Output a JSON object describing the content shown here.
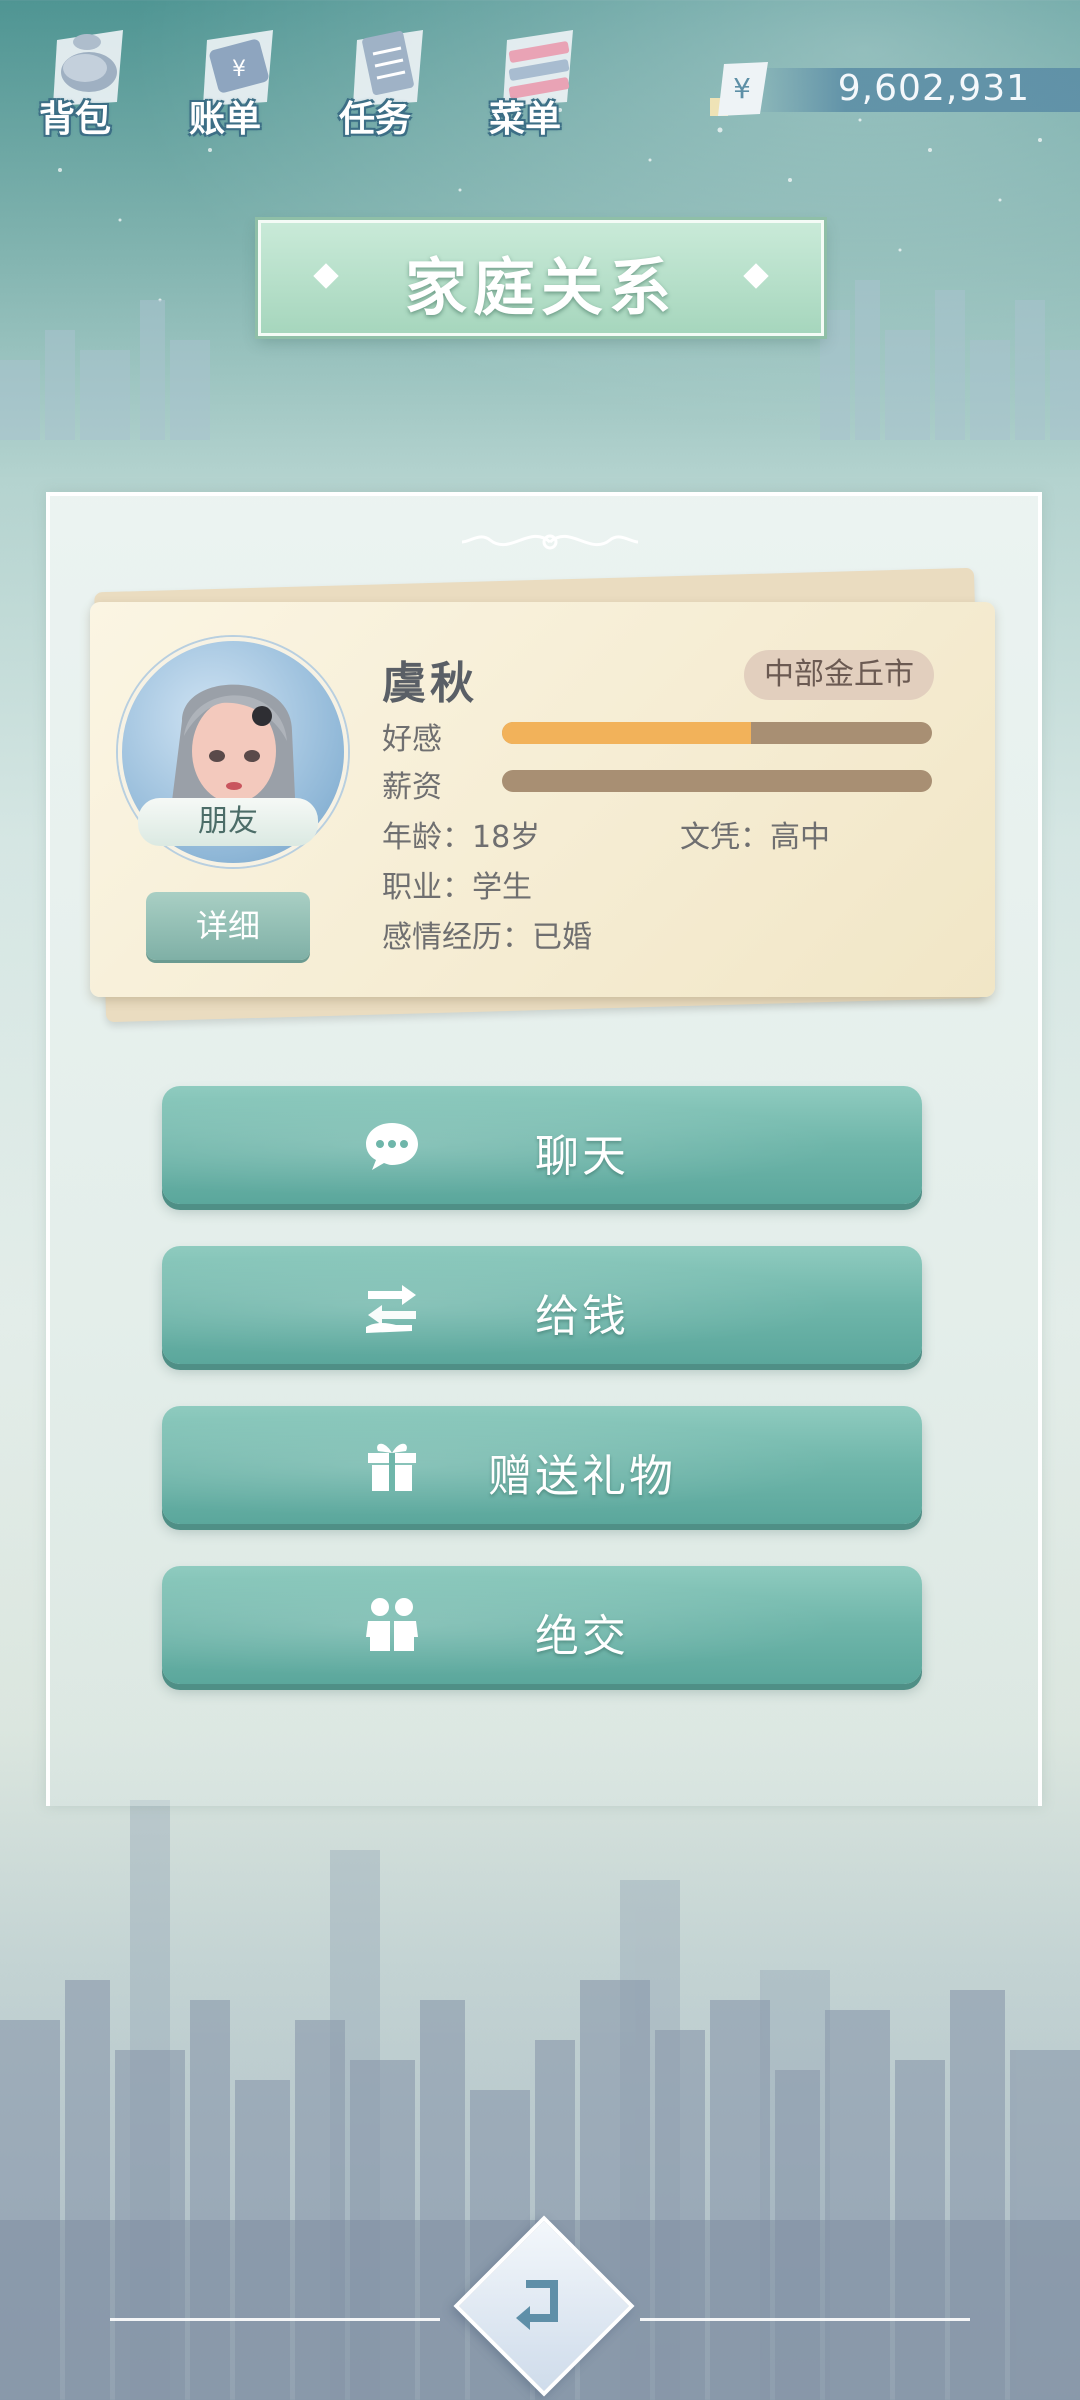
{
  "toolbar": {
    "items": [
      {
        "label": "背包",
        "icon": "backpack-icon"
      },
      {
        "label": "账单",
        "icon": "bill-icon"
      },
      {
        "label": "任务",
        "icon": "task-icon"
      },
      {
        "label": "菜单",
        "icon": "menu-icon"
      }
    ]
  },
  "money": {
    "currency_symbol": "¥",
    "value": "9,602,931"
  },
  "title": "家庭关系",
  "profile": {
    "name": "虞秋",
    "location": "中部金丘市",
    "relation": "朋友",
    "detail_label": "详细",
    "favor_label": "好感",
    "favor_level": 0.58,
    "salary_label": "薪资",
    "salary_level": 0.0,
    "age": "年龄：18岁",
    "education": "文凭：高中",
    "job": "职业：学生",
    "relationship_history": "感情经历：已婚"
  },
  "actions": [
    {
      "label": "聊天",
      "icon": "chat-bubble-icon"
    },
    {
      "label": "给钱",
      "icon": "give-money-icon"
    },
    {
      "label": "赠送礼物",
      "icon": "gift-icon"
    },
    {
      "label": "绝交",
      "icon": "break-friendship-icon"
    }
  ],
  "colors": {
    "accent_teal": "#6fb6aa",
    "favor_bar": "#f2b25a",
    "bar_track": "#a88f73",
    "card_bg": "#f8f0da"
  }
}
